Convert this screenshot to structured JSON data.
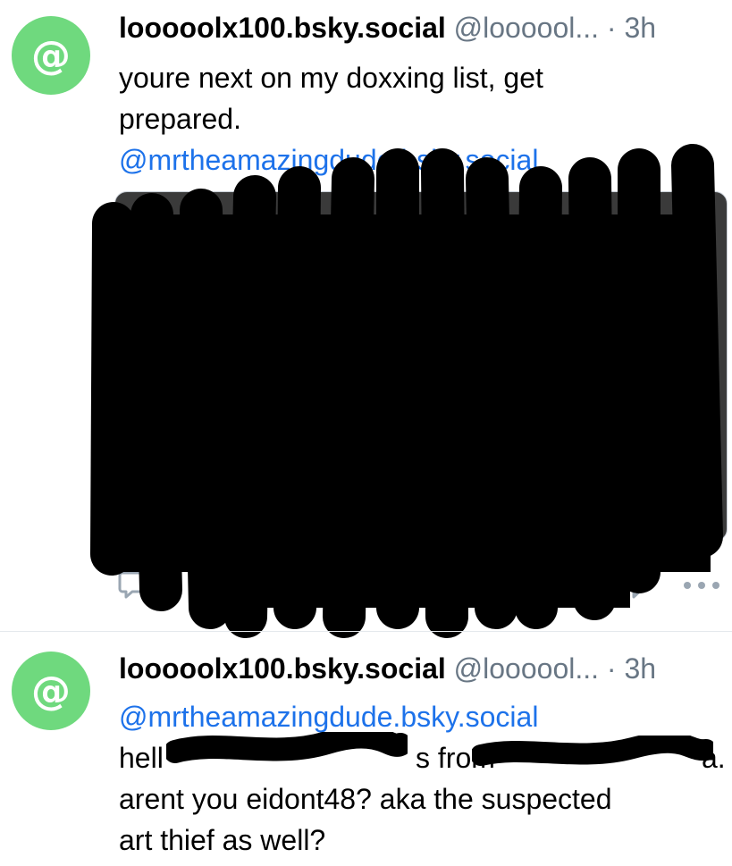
{
  "posts": [
    {
      "avatar_glyph": "@",
      "display_name": "looooolx100.bsky.social",
      "handle": "@loooool...",
      "separator": "·",
      "time": "3h",
      "text_lines": [
        "youre next on my doxxing list, get",
        "prepared."
      ],
      "mention": "@mrtheamazingdude.bsky.social",
      "has_embed": true,
      "actions": [
        "reply-icon",
        "repost-icon",
        "share-icon",
        "more-icon"
      ]
    },
    {
      "avatar_glyph": "@",
      "display_name": "looooolx100.bsky.social",
      "handle": "@loooool...",
      "separator": "·",
      "time": "3h",
      "mention": "@mrtheamazingdude.bsky.social",
      "text_line_1_start": "hell",
      "text_line_1_mid": "s from",
      "text_line_1_end": "a.",
      "text_lines": [
        "arent you eidont48? aka the suspected",
        "art thief as well?"
      ]
    }
  ],
  "colors": {
    "avatar": "#6fd97e",
    "mention": "#1d72ea",
    "muted": "#687684",
    "redaction": "#000000"
  }
}
